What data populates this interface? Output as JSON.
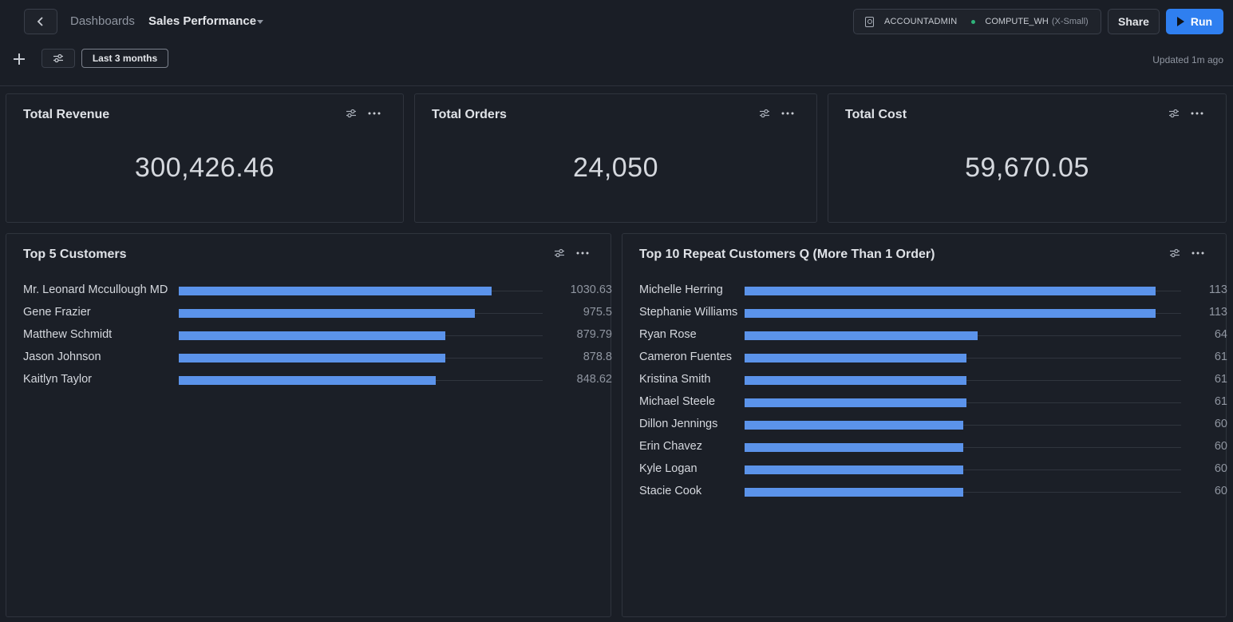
{
  "header": {
    "breadcrumb_root": "Dashboards",
    "dashboard_title": "Sales Performance",
    "role": "ACCOUNTADMIN",
    "warehouse": "COMPUTE_WH",
    "warehouse_size": "(X-Small)",
    "share_label": "Share",
    "run_label": "Run"
  },
  "filters": {
    "date_range": "Last 3 months",
    "updated": "Updated 1m ago"
  },
  "kpis": [
    {
      "title": "Total Revenue",
      "value": "300,426.46"
    },
    {
      "title": "Total Orders",
      "value": "24,050"
    },
    {
      "title": "Total Cost",
      "value": "59,670.05"
    }
  ],
  "colors": {
    "accent": "#2f7ff0",
    "bar": "#5b93ea",
    "background": "#1a1e26",
    "status_dot": "#2fb37a"
  },
  "icons": [
    "chevron-left-icon",
    "caret-down-icon",
    "role-icon",
    "plus-icon",
    "sliders-icon",
    "more-dots-icon",
    "play-icon"
  ],
  "chart_data": [
    {
      "type": "bar",
      "orientation": "horizontal",
      "title": "Top 5 Customers",
      "categories": [
        "Mr. Leonard Mccullough MD",
        "Gene Frazier",
        "Matthew Schmidt",
        "Jason Johnson",
        "Kaitlyn Taylor"
      ],
      "values": [
        1030.63,
        975.5,
        879.79,
        878.8,
        848.62
      ],
      "value_labels": [
        "1030.63",
        "975.5",
        "879.79",
        "878.8",
        "848.62"
      ],
      "xlim": [
        0,
        1200
      ]
    },
    {
      "type": "bar",
      "orientation": "horizontal",
      "title": "Top 10 Repeat Customers Q (More Than 1 Order)",
      "categories": [
        "Michelle Herring",
        "Stephanie Williams",
        "Ryan Rose",
        "Cameron Fuentes",
        "Kristina Smith",
        "Michael Steele",
        "Dillon Jennings",
        "Erin Chavez",
        "Kyle Logan",
        "Stacie Cook"
      ],
      "values": [
        113,
        113,
        64,
        61,
        61,
        61,
        60,
        60,
        60,
        60
      ],
      "value_labels": [
        "113",
        "113",
        "64",
        "61",
        "61",
        "61",
        "60",
        "60",
        "60",
        "60"
      ],
      "xlim": [
        0,
        120
      ]
    }
  ]
}
